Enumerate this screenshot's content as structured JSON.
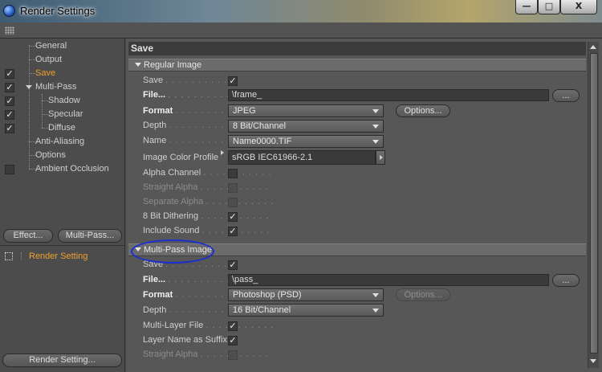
{
  "window": {
    "title": "Render Settings"
  },
  "title_controls": {
    "minimize": "—",
    "maximize": "□",
    "close": "X"
  },
  "tree": {
    "items": [
      {
        "label": "General",
        "checked": null,
        "active": false
      },
      {
        "label": "Output",
        "checked": null,
        "active": false
      },
      {
        "label": "Save",
        "checked": true,
        "active": true
      },
      {
        "label": "Multi-Pass",
        "checked": true,
        "active": false
      },
      {
        "label": "Shadow",
        "checked": true,
        "active": false
      },
      {
        "label": "Specular",
        "checked": true,
        "active": false
      },
      {
        "label": "Diffuse",
        "checked": true,
        "active": false
      },
      {
        "label": "Anti-Aliasing",
        "checked": null,
        "active": false
      },
      {
        "label": "Options",
        "checked": null,
        "active": false
      },
      {
        "label": "Ambient Occlusion",
        "checked": false,
        "active": false
      }
    ],
    "checkmark": "✓"
  },
  "left_buttons": {
    "effect": "Effect...",
    "multipass": "Multi-Pass..."
  },
  "render_setting_list": {
    "item": "Render Setting"
  },
  "render_setting_button": "Render Setting...",
  "panel": {
    "header": "Save",
    "regular": {
      "section": "Regular Image",
      "save_label": "Save",
      "file_label": "File...",
      "file_value": "\\frame_",
      "browse": "...",
      "format_label": "Format",
      "format_value": "JPEG",
      "options": "Options...",
      "depth_label": "Depth",
      "depth_value": "8 Bit/Channel",
      "name_label": "Name",
      "name_value": "Name0000.TIF",
      "profile_label": "Image Color Profile",
      "profile_value": "sRGB IEC61966-2.1",
      "alpha_label": "Alpha Channel",
      "straight_label": "Straight Alpha",
      "separate_label": "Separate Alpha",
      "dither_label": "8 Bit Dithering",
      "sound_label": "Include Sound"
    },
    "multipass": {
      "section": "Multi-Pass Image",
      "save_label": "Save",
      "file_label": "File...",
      "file_value": "\\pass_",
      "browse": "...",
      "format_label": "Format",
      "format_value": "Photoshop (PSD)",
      "options": "Options...",
      "depth_label": "Depth",
      "depth_value": "16 Bit/Channel",
      "layerfile_label": "Multi-Layer File",
      "suffix_label": "Layer Name as Suffix",
      "straight_label": "Straight Alpha"
    },
    "dots": ". . . . . . . . . . ."
  },
  "colors": {
    "accent": "#f0a030",
    "annotation": "#1a2fd0"
  }
}
